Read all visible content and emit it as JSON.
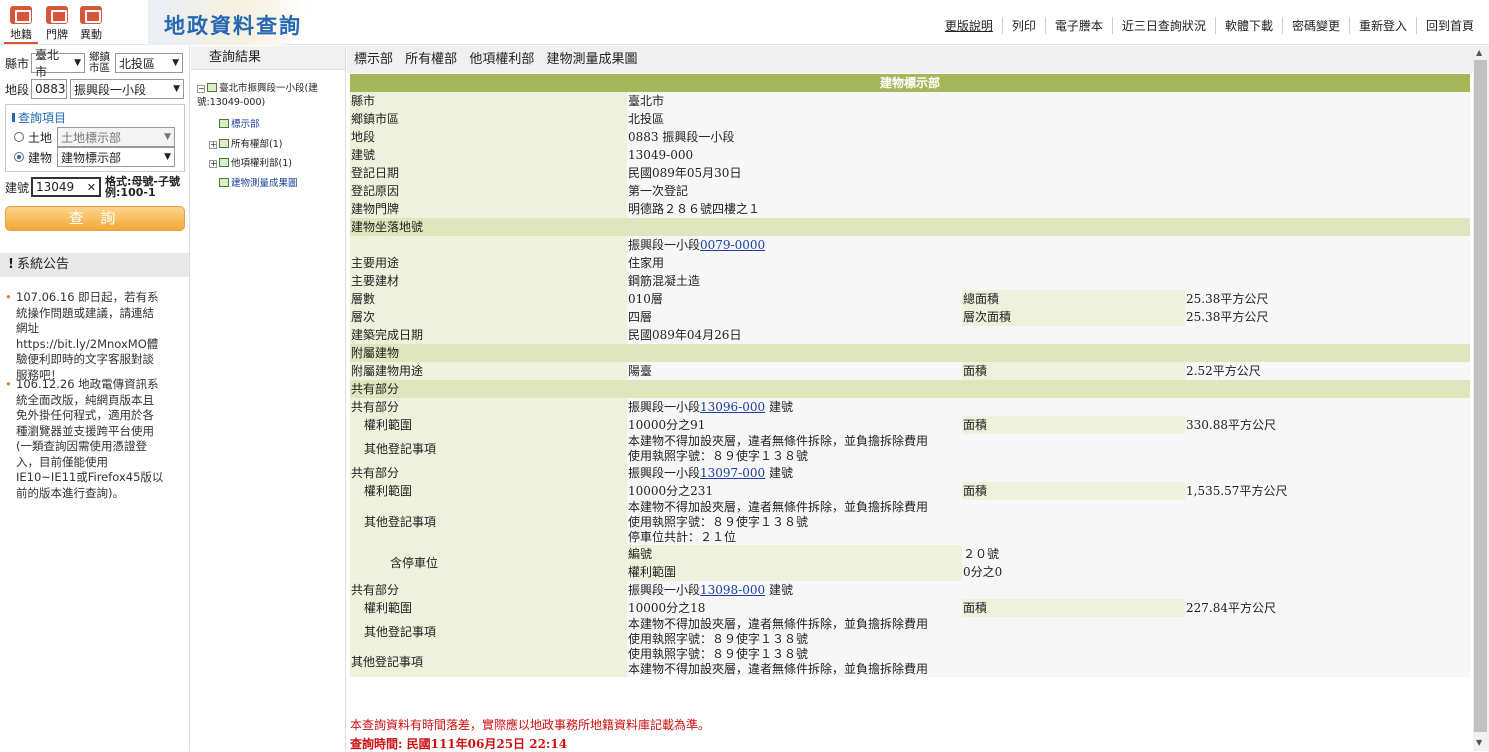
{
  "header": {
    "icons": [
      {
        "label": "地籍",
        "icon": "cadastre-icon"
      },
      {
        "label": "門牌",
        "icon": "house-icon"
      },
      {
        "label": "異動",
        "icon": "change-icon"
      }
    ],
    "title": "地政資料查詢",
    "nav": [
      "更版說明",
      "列印",
      "電子謄本",
      "近三日查詢狀況",
      "軟體下載",
      "密碼變更",
      "重新登入",
      "回到首頁"
    ]
  },
  "left": {
    "county_label": "縣市",
    "county": "臺北市",
    "district_label": "鄉鎮市區",
    "district": "北投區",
    "section_label": "地段",
    "section_code": "0883",
    "section": "振興段一小段",
    "query_title": "查詢項目",
    "land_label": "土地",
    "land_select": "土地標示部",
    "building_label": "建物",
    "building_select": "建物標示部",
    "bno_label": "建號",
    "bno": "13049",
    "format_hint": "格式:母號-子號",
    "format_example": "例:100-1",
    "query_button": "查 詢",
    "announce_title": "系統公告",
    "announcements": [
      "107.06.16 即日起，若有系統操作問題或建議，請連結網址https://bit.ly/2MnoxMO體驗便利即時的文字客服對談服務吧！",
      "106.12.26 地政電傳資訊系統全面改版，純網頁版本且免外掛任何程式，適用於各種瀏覽器並支援跨平台使用(一類查詢因需使用憑證登入，目前僅能使用IE10~IE11或Firefox45版以前的版本進行查詢)。"
    ]
  },
  "tree": {
    "title": "查詢結果",
    "root": "臺北市振興段一小段(建號:13049-000)",
    "items": [
      "標示部",
      "所有權部(1)",
      "他項權利部(1)",
      "建物測量成果圖"
    ]
  },
  "tabs": [
    "標示部",
    "所有權部",
    "他項權利部",
    "建物測量成果圖"
  ],
  "record": {
    "caption": "建物標示部",
    "county_l": "縣市",
    "county": "臺北市",
    "district_l": "鄉鎮市區",
    "district": "北投區",
    "section_l": "地段",
    "section": "0883 振興段一小段",
    "bno_l": "建號",
    "bno": "13049-000",
    "regdate_l": "登記日期",
    "regdate": "民國089年05月30日",
    "reason_l": "登記原因",
    "reason": "第一次登記",
    "door_l": "建物門牌",
    "door": "明德路２８６號四樓之１",
    "loc_head": "建物坐落地號",
    "loc_prefix": "振興段一小段",
    "loc_link": "0079-0000",
    "use_l": "主要用途",
    "use": "住家用",
    "mat_l": "主要建材",
    "mat": "鋼筋混凝土造",
    "floors_l": "層數",
    "floors": "010層",
    "total_l": "總面積",
    "total": "25.38平方公尺",
    "floor_l": "層次",
    "floor": "四層",
    "floor_area_l": "層次面積",
    "floor_area": "25.38平方公尺",
    "done_l": "建築完成日期",
    "done": "民國089年04月26日",
    "attach_head": "附屬建物",
    "attach_use_l": "附屬建物用途",
    "attach_use": "陽臺",
    "attach_area_l": "面積",
    "attach_area": "2.52平方公尺",
    "common_head": "共有部分",
    "common": [
      {
        "label": "共有部分",
        "prefix": "振興段一小段",
        "link": "13096-000",
        "suffix": " 建號",
        "right_l": "權利範圍",
        "right": "10000分之91",
        "area_l": "面積",
        "area": "330.88平方公尺",
        "other_l": "其他登記事項",
        "other": [
          "本建物不得加設夾層，違者無條件拆除，並負擔拆除費用",
          "使用執照字號：８９使字１３８號"
        ]
      },
      {
        "label": "共有部分",
        "prefix": "振興段一小段",
        "link": "13097-000",
        "suffix": " 建號",
        "right_l": "權利範圍",
        "right": "10000分之231",
        "area_l": "面積",
        "area": "1,535.57平方公尺",
        "other_l": "其他登記事項",
        "other": [
          "本建物不得加設夾層，違者無條件拆除，並負擔拆除費用",
          "使用執照字號：８９使字１３８號",
          "停車位共計：２１位"
        ]
      },
      {
        "label": "共有部分",
        "prefix": "振興段一小段",
        "link": "13098-000",
        "suffix": " 建號",
        "right_l": "權利範圍",
        "right": "10000分之18",
        "area_l": "面積",
        "area": "227.84平方公尺",
        "other_l": "其他登記事項",
        "other": [
          "本建物不得加設夾層，違者無條件拆除，並負擔拆除費用",
          "使用執照字號：８９使字１３８號"
        ]
      }
    ],
    "parking_l": "含停車位",
    "parking_no_l": "編號",
    "parking_no": "２０號",
    "parking_right_l": "權利範圍",
    "parking_right": "0分之0",
    "other_l": "其他登記事項",
    "other": [
      "使用執照字號：８９使字１３８號",
      "本建物不得加設夾層，違者無條件拆除，並負擔拆除費用"
    ]
  },
  "notice": "本查詢資料有時間落差，實際應以地政事務所地籍資料庫記載為準。",
  "query_time": "查詢時間: 民國111年06月25日 22:14"
}
